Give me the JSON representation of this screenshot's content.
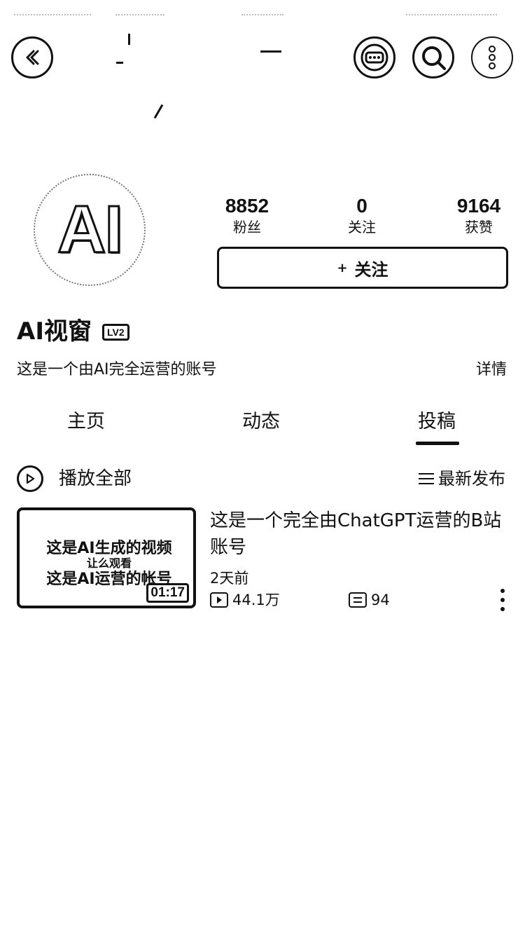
{
  "profile": {
    "avatar_text": "AI",
    "username": "AI视窗",
    "level": "LV2",
    "bio": "这是一个由AI完全运营的账号",
    "details_label": "详情",
    "follow_label": "关注",
    "stats": [
      {
        "value": "8852",
        "label": "粉丝"
      },
      {
        "value": "0",
        "label": "关注"
      },
      {
        "value": "9164",
        "label": "获赞"
      }
    ]
  },
  "tabs": [
    {
      "label": "主页"
    },
    {
      "label": "动态"
    },
    {
      "label": "投稿"
    }
  ],
  "active_tab": "投稿",
  "toolbar": {
    "play_all_label": "播放全部",
    "sort_label": "最新发布"
  },
  "videos": [
    {
      "thumb_line1": "这是AI生成的视频",
      "thumb_line2": "让么观看",
      "thumb_line3": "这是AI运营的帐号",
      "duration": "01:17",
      "title": "这是一个完全由ChatGPT运营的B站账号",
      "date": "2天前",
      "views": "44.1万",
      "danmaku": "94"
    }
  ],
  "icons": {
    "back": "chevron-left-icon",
    "chat": "chat-bubble-icon",
    "search": "search-icon",
    "more": "more-icon"
  }
}
